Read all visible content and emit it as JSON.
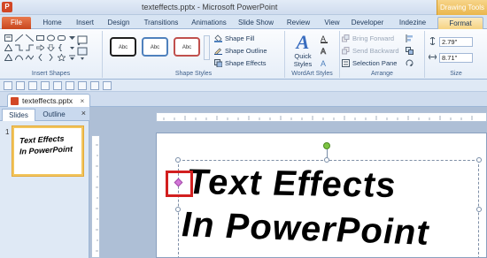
{
  "window": {
    "title": "texteffects.pptx - Microsoft PowerPoint",
    "app_icon_letter": "P",
    "contextual_header": "Drawing Tools"
  },
  "ribbon_tabs": [
    "File",
    "Home",
    "Insert",
    "Design",
    "Transitions",
    "Animations",
    "Slide Show",
    "Review",
    "View",
    "Developer",
    "Indezine",
    "Format"
  ],
  "ribbon": {
    "insert_shapes": {
      "label": "Insert Shapes"
    },
    "shape_styles": {
      "label": "Shape Styles",
      "swatch_text": "Abc",
      "shape_fill": "Shape Fill",
      "shape_outline": "Shape Outline",
      "shape_effects": "Shape Effects"
    },
    "wordart_styles": {
      "label": "WordArt Styles",
      "quick_styles": "Quick Styles",
      "quick_styles_icon": "A"
    },
    "arrange": {
      "label": "Arrange",
      "bring_forward": "Bring Forward",
      "send_backward": "Send Backward",
      "selection_pane": "Selection Pane"
    },
    "size": {
      "label": "Size",
      "height": "2.79\"",
      "width": "8.71\""
    }
  },
  "document_tab": {
    "name": "texteffects.pptx",
    "close": "×"
  },
  "left_pane": {
    "tabs": {
      "slides": "Slides",
      "outline": "Outline"
    },
    "close": "×",
    "slide_number": "1",
    "thumb_line1": "Text Effects",
    "thumb_line2": "In PowerPoint"
  },
  "slide": {
    "line1": "Text Effects",
    "line2": "In PowerPoint"
  },
  "colors": {
    "file_tab": "#c8461d",
    "highlight_callout": "#d21f1f",
    "rotation_handle": "#7dc442",
    "adjust_handle": "#d277d8"
  }
}
